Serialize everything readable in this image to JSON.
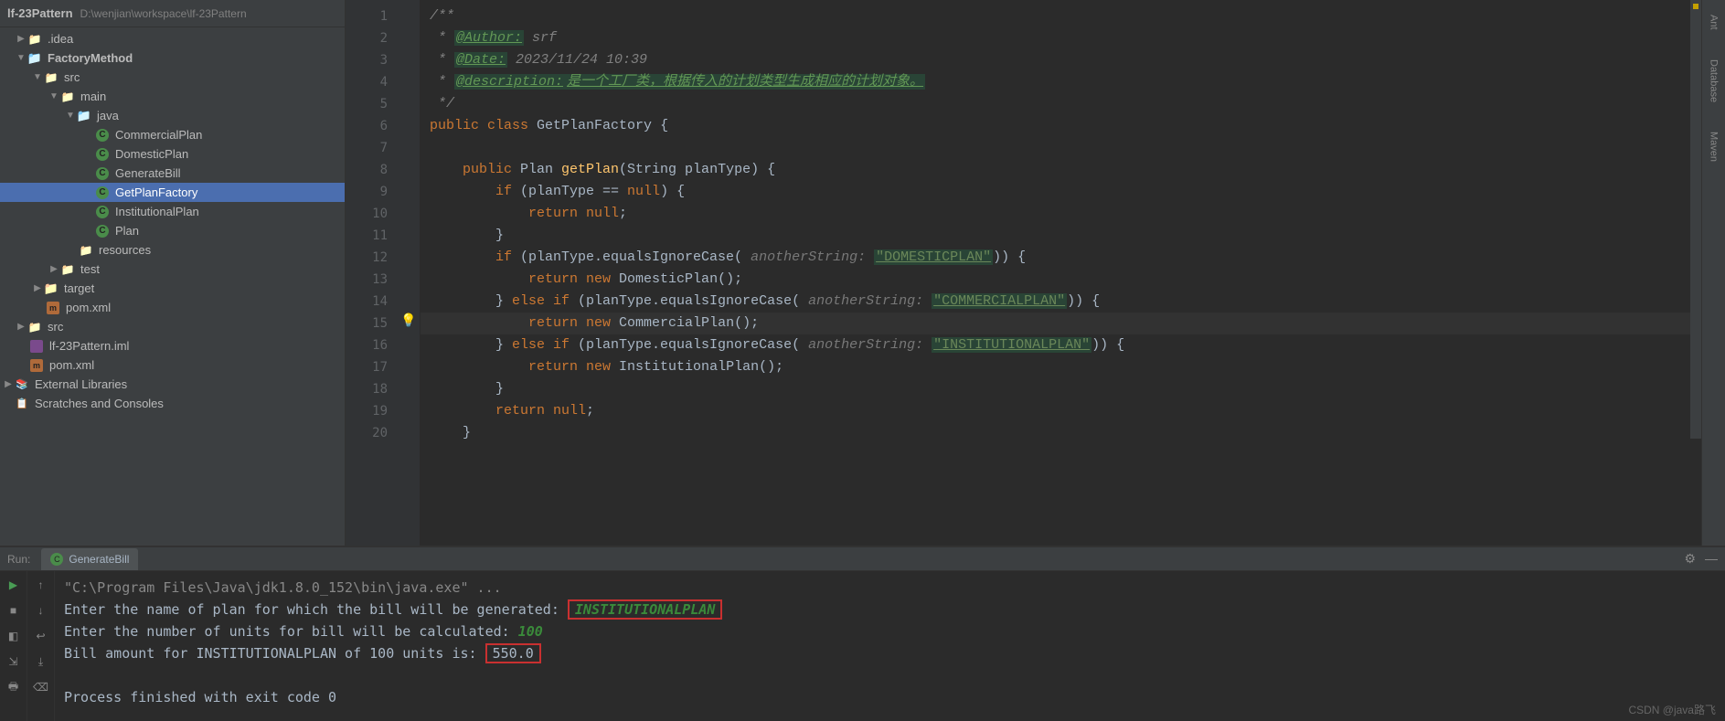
{
  "project": {
    "name": "lf-23Pattern",
    "path": "D:\\wenjian\\workspace\\lf-23Pattern"
  },
  "tree": {
    "idea": ".idea",
    "factoryMethod": "FactoryMethod",
    "src": "src",
    "main": "main",
    "java": "java",
    "files": {
      "commercialPlan": "CommercialPlan",
      "domesticPlan": "DomesticPlan",
      "generateBill": "GenerateBill",
      "getPlanFactory": "GetPlanFactory",
      "institutionalPlan": "InstitutionalPlan",
      "plan": "Plan"
    },
    "resources": "resources",
    "test": "test",
    "target": "target",
    "pom": "pom.xml",
    "srcOuter": "src",
    "iml": "lf-23Pattern.iml",
    "pomOuter": "pom.xml",
    "extLib": "External Libraries",
    "scratch": "Scratches and Consoles"
  },
  "gutter": [
    "1",
    "2",
    "3",
    "4",
    "5",
    "6",
    "7",
    "8",
    "9",
    "10",
    "11",
    "12",
    "13",
    "14",
    "15",
    "16",
    "17",
    "18",
    "19",
    "20"
  ],
  "code": {
    "l1": "/**",
    "l2a": " * ",
    "l2tag": "@Author:",
    "l2b": " srf",
    "l3a": " * ",
    "l3tag": "@Date:",
    "l3b": " 2023/11/24 10:39",
    "l4a": " * ",
    "l4tag": "@description:",
    "l4b": "是一个工厂类，根据传入的计划类型生成相应的计划对象。",
    "l5": " */",
    "l6a": "public",
    "l6b": " class ",
    "l6c": "GetPlanFactory ",
    "l6d": "{",
    "l8a": "    public",
    "l8b": " Plan ",
    "l8c": "getPlan",
    "l8d": "(String planType) {",
    "l9a": "        if",
    "l9b": " (planType == ",
    "l9c": "null",
    "l9d": ") {",
    "l10a": "            return null",
    "l10b": ";",
    "l11": "        }",
    "l12a": "        if",
    "l12b": " (planType.equalsIgnoreCase( ",
    "l12h": "anotherString: ",
    "l12s": "\"DOMESTICPLAN\"",
    "l12c": ")) {",
    "l13a": "            return new ",
    "l13b": "DomesticPlan();",
    "l14a": "        } ",
    "l14b": "else if",
    "l14c": " (planType.equalsIgnoreCase( ",
    "l14h": "anotherString: ",
    "l14s": "\"COMMERCIALPLAN\"",
    "l14d": ")) {",
    "l15a": "            return new ",
    "l15b": "CommercialPlan();",
    "l16a": "        } ",
    "l16b": "else if",
    "l16c": " (planType.equalsIgnoreCase( ",
    "l16h": "anotherString: ",
    "l16s": "\"INSTITUTIONALPLAN\"",
    "l16d": ")) {",
    "l17a": "            return new ",
    "l17b": "InstitutionalPlan();",
    "l18": "        }",
    "l19a": "        return null",
    "l19b": ";",
    "l20": "    }"
  },
  "rightBar": {
    "ant": "Ant",
    "database": "Database",
    "maven": "Maven"
  },
  "run": {
    "label": "Run:",
    "tab": "GenerateBill",
    "line1": "\"C:\\Program Files\\Java\\jdk1.8.0_152\\bin\\java.exe\" ...",
    "line2a": "Enter the name of plan for which the bill will be generated: ",
    "line2b": "INSTITUTIONALPLAN",
    "line3a": "Enter the number of units for bill will be calculated: ",
    "line3b": "100",
    "line4a": "Bill amount for INSTITUTIONALPLAN of 100 units is: ",
    "line4b": "550.0",
    "line5": "Process finished with exit code 0",
    "gear": "⚙",
    "minimize": "—"
  },
  "watermark": "CSDN @java路飞"
}
